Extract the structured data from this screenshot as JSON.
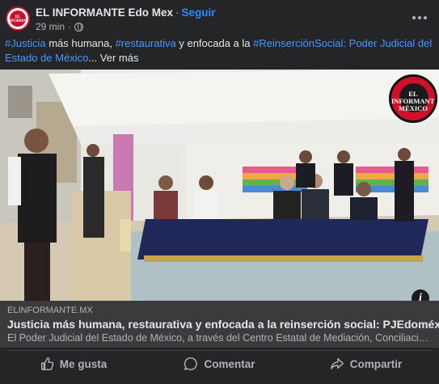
{
  "header": {
    "page_name": "EL INFORMANTE Edo Mex",
    "separator": "·",
    "follow_label": "Seguir",
    "time": "29 min",
    "meta_separator": "·",
    "avatar_text": "EL INFORMANTE",
    "privacy_icon": "globe-icon",
    "menu_icon": "more-options-icon"
  },
  "caption": {
    "parts": [
      {
        "text": "#Justicia",
        "type": "tag"
      },
      {
        "text": " más humana, ",
        "type": "text"
      },
      {
        "text": "#restaurativa",
        "type": "tag"
      },
      {
        "text": " y enfocada a la ",
        "type": "text"
      },
      {
        "text": "#ReinserciónSocial",
        "type": "tag"
      },
      {
        "text": ": Poder Judicial del Estado de México",
        "type": "tag"
      },
      {
        "text": "... ",
        "type": "text"
      }
    ],
    "see_more": "Ver más"
  },
  "photo": {
    "watermark_text": "EL INFORMANTE MÉXICO",
    "info_label": "i"
  },
  "link": {
    "domain": "ELINFORMANTE.MX",
    "title": "Justicia más humana, restaurativa y enfocada a la reinserción social: PJEdoméx",
    "description": "El Poder Judicial del Estado de México, a través del Centro Estatal de Mediación, Conciliación y de Justicia Restaurativa"
  },
  "actions": [
    {
      "label": "Me gusta",
      "icon": "thumbs-up-icon"
    },
    {
      "label": "Comentar",
      "icon": "comment-icon"
    },
    {
      "label": "Compartir",
      "icon": "share-icon"
    }
  ],
  "colors": {
    "background": "#242526",
    "link_blue": "#2d88ff",
    "tag_blue": "#4599ff",
    "text_primary": "#e4e6eb",
    "text_secondary": "#b0b3b8",
    "brand_red": "#c8102e"
  }
}
